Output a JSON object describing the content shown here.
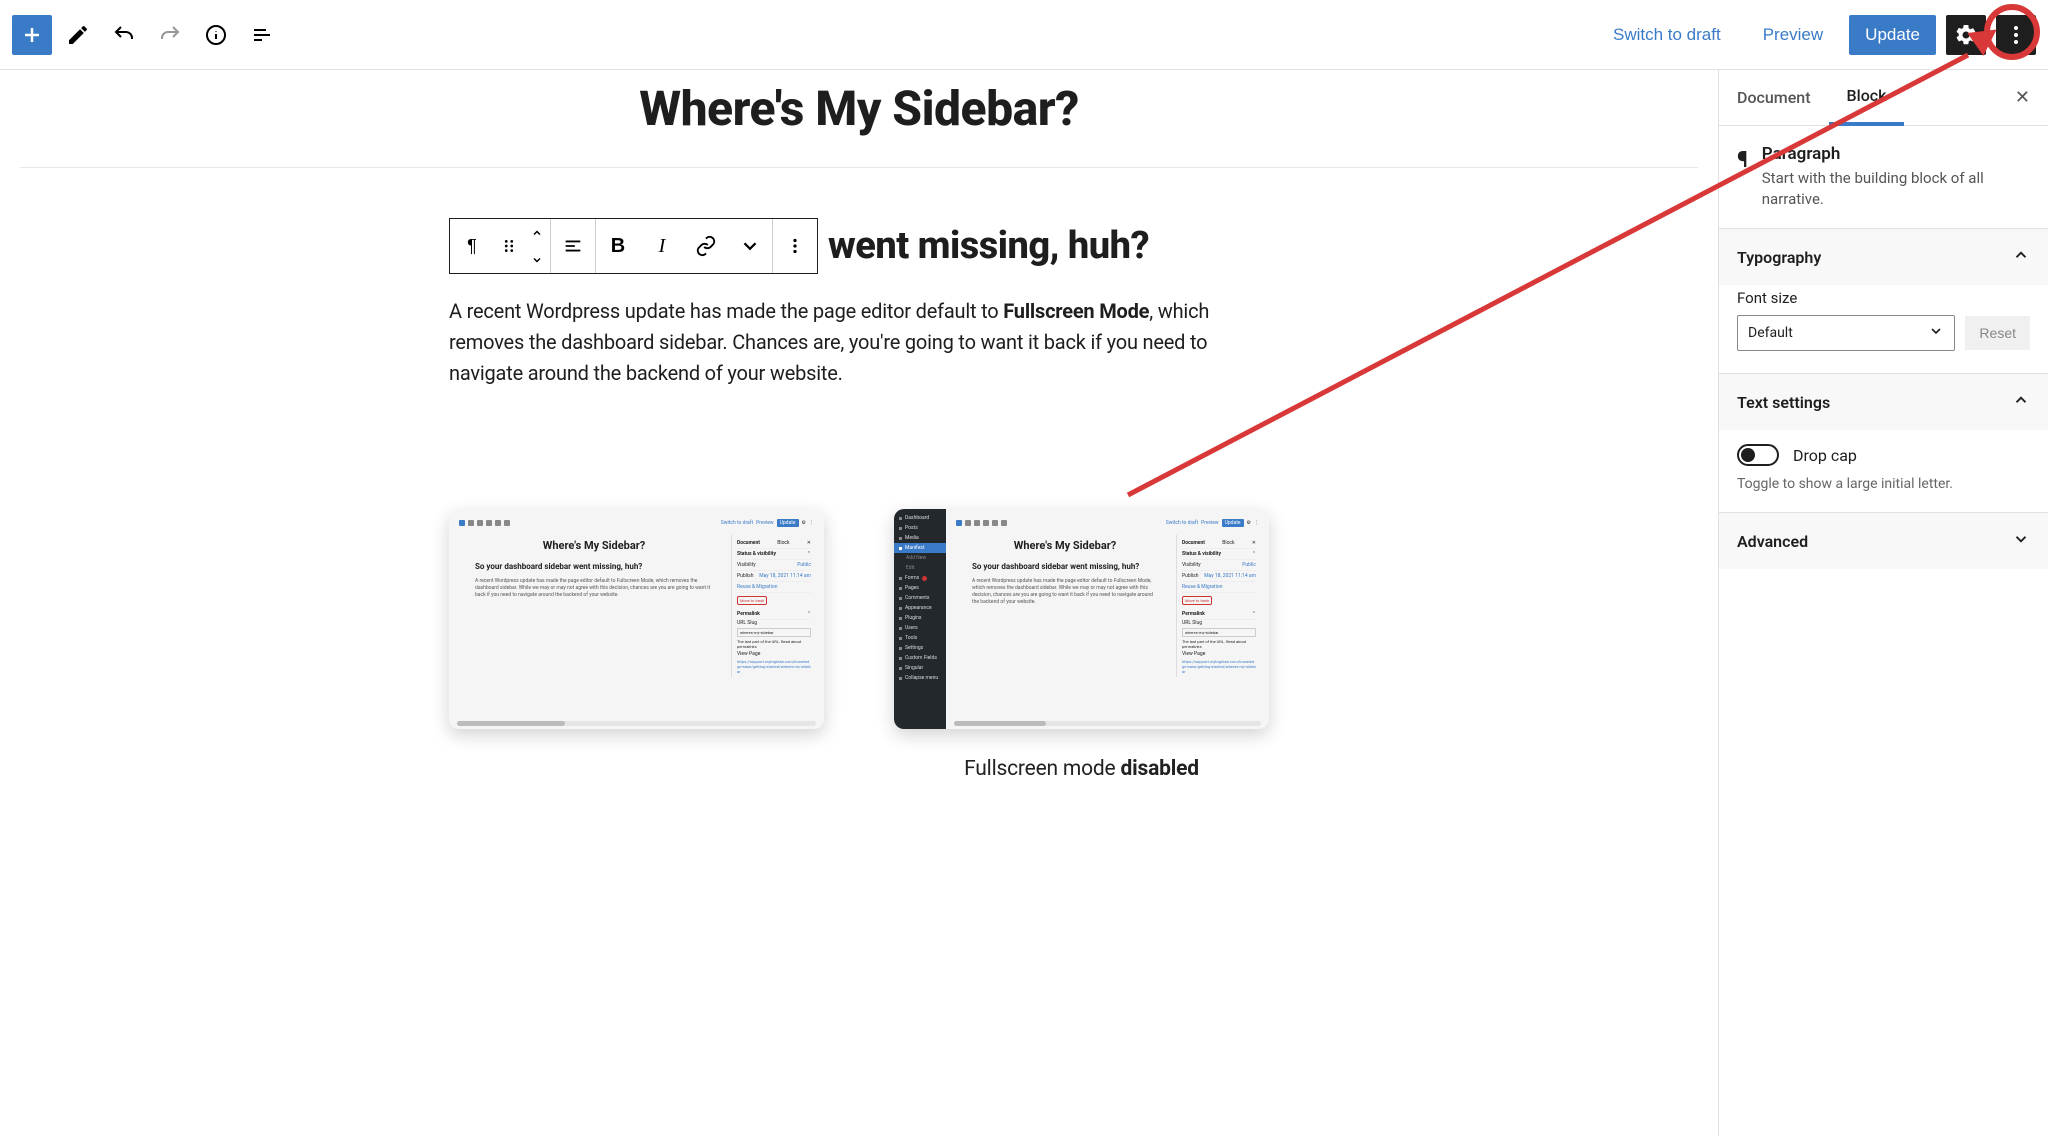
{
  "topbar": {
    "switch_draft": "Switch to draft",
    "preview": "Preview",
    "update": "Update"
  },
  "editor": {
    "page_title": "Where's My Sidebar?",
    "heading_partial": "went missing, huh?",
    "paragraph_pre": "A recent Wordpress update has made the page editor default to ",
    "paragraph_bold": "Fullscreen Mode",
    "paragraph_post": ", which removes the dashboard sidebar. Chances are, you're going to want it back if you need to navigate around the backend of your website.",
    "caption_right_pre": "Fullscreen mode ",
    "caption_right_bold": "disabled"
  },
  "thumbnail": {
    "title": "Where's My Sidebar?",
    "subtitle": "So your dashboard sidebar went missing, huh?",
    "body": "A recent Wordpress update has made the page editor default to Fullscreen Mode, which removes the dashboard sidebar. While we may or may not agree with this decision, chances are you are going to want it back if you need to navigate around the backend of your website.",
    "side": {
      "doc": "Document",
      "block": "Block",
      "status": "Status & visibility",
      "visibility": "Visibility",
      "visibility_v": "Public",
      "publish": "Publish",
      "publish_v": "May 18, 2021 11:14 am",
      "trash": "Move to trash",
      "permalink": "Permalink",
      "url_slug": "URL Slug",
      "slug_val": "wheres-my-sidebar",
      "url_desc": "The last part of the URL. Read about permalinks",
      "view_page": "View Page",
      "link": "https://support.mytrigirlab.com/knowledge-base/getting-started/wheres-my-sidebar"
    },
    "nav": [
      "Dashboard",
      "Posts",
      "Media",
      "Manifest",
      "Add New",
      "Edit",
      "Forms",
      "Pages",
      "Comments",
      "Appearance",
      "Plugins",
      "Users",
      "Tools",
      "Settings",
      "Custom Fields",
      "Singular",
      "Collapse menu"
    ]
  },
  "sidebar": {
    "tab_document": "Document",
    "tab_block": "Block",
    "block_name": "Paragraph",
    "block_desc": "Start with the building block of all narrative.",
    "typography": {
      "title": "Typography",
      "font_size_label": "Font size",
      "font_size_value": "Default",
      "reset": "Reset"
    },
    "text_settings": {
      "title": "Text settings",
      "drop_cap": "Drop cap",
      "hint": "Toggle to show a large initial letter."
    },
    "advanced": "Advanced"
  }
}
